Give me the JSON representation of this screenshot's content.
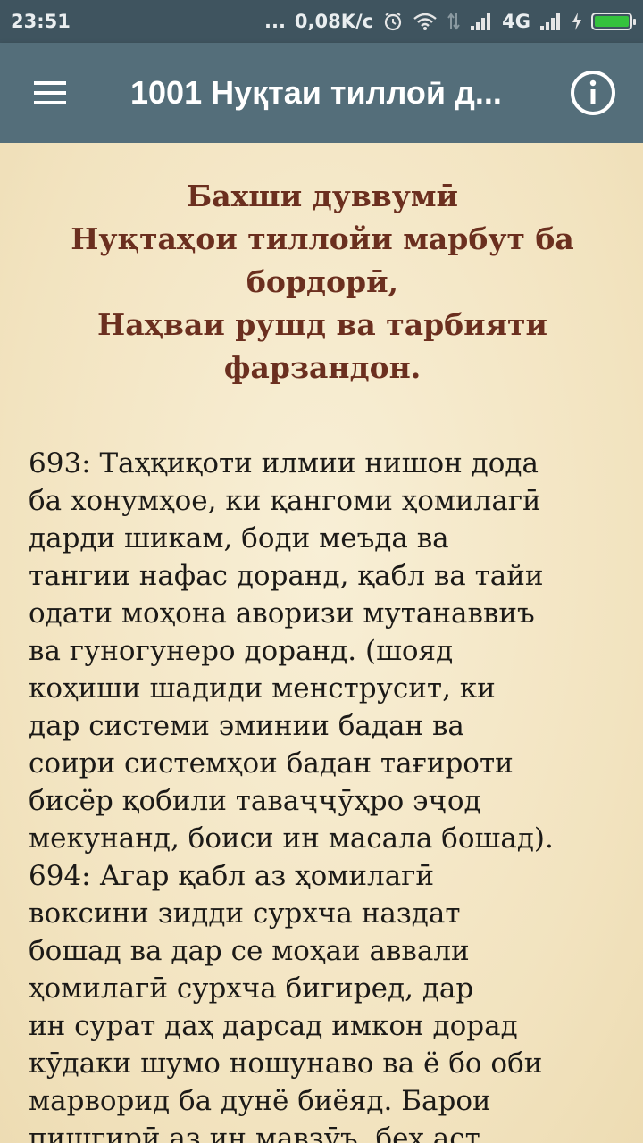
{
  "status_bar": {
    "time": "23:51",
    "dots": "...",
    "speed": "0,08K/c",
    "network": "4G",
    "icons": [
      "alarm-icon",
      "wifi-icon",
      "data-arrows-icon",
      "signal-icon",
      "signal-icon",
      "charging-icon",
      "battery-icon"
    ],
    "battery_color": "#35c23d"
  },
  "app_bar": {
    "title": "1001 Нуқтаи тиллоӣ д...",
    "background": "#546e7a"
  },
  "content": {
    "heading_lines": [
      "Бахши дуввумӣ",
      "Нуқтаҳои тиллойи марбут ба",
      "бордорӣ,",
      "Наҳваи рушд ва тарбияти",
      "фарзандон."
    ],
    "heading_color": "#6b2f1f",
    "body_lines": [
      "693: Таҳқиқоти илмии нишон дода",
      "ба хонумҳое, ки қангоми ҳомилагӣ",
      "дарди шикам, боди меъда ва",
      "тангии нафас доранд, қабл ва тайи",
      "одати моҳона аворизи мутанаввиъ",
      "ва гуногунеро доранд. (шояд",
      "коҳиши шадиди менструсит, ки",
      "дар системи эминии бадан ва",
      "соири системҳои бадан тағироти",
      "бисёр қобили таваҷҷӯҳро эҷод",
      "мекунанд, боиси ин масала бошад).",
      "694: Агар қабл аз ҳомилагӣ",
      "воксини зидди сурхча наздат",
      "бошад ва дар се моҳаи аввали",
      "ҳомилагӣ сурхча бигиред, дар",
      "ин сурат даҳ дарсад имкон дорад",
      "кӯдаки шумо ношунаво ва ё бо оби",
      "марворид ба дунё биёяд. Барои",
      "пишгирӣ аз ин мавзӯъ, беҳ аст"
    ]
  }
}
